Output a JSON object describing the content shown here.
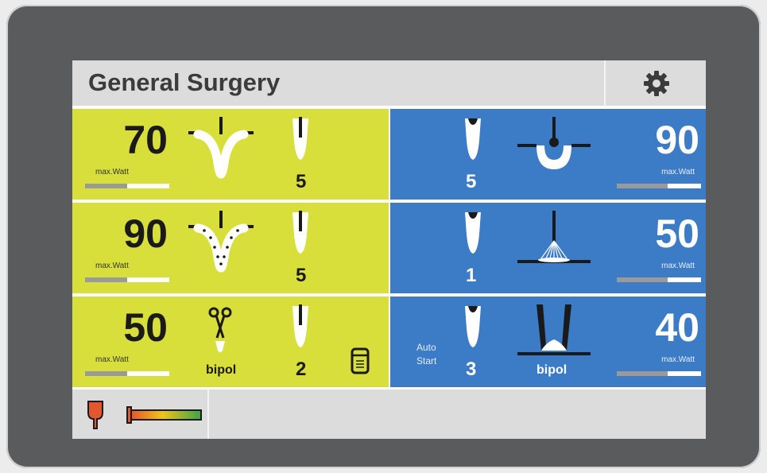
{
  "header": {
    "title": "General Surgery",
    "settings_icon": "gear-icon"
  },
  "unit_label": "max.Watt",
  "monopolar": [
    {
      "power": "70",
      "mode_icon": "cut-mode-icon",
      "electrode_icon": "electrode-tip-icon",
      "level": "5",
      "power_fraction": 0.5
    },
    {
      "power": "90",
      "mode_icon": "blend-cut-mode-icon",
      "electrode_icon": "electrode-tip-icon",
      "level": "5",
      "power_fraction": 0.5
    },
    {
      "power": "50",
      "mode_icon": "bipolar-scissors-icon",
      "mode_label": "bipol",
      "electrode_icon": "electrode-tip-icon",
      "level": "2",
      "extra_icon": "footswitch-icon",
      "power_fraction": 0.5
    }
  ],
  "coagulation": [
    {
      "power": "90",
      "mode_icon": "soft-coag-icon",
      "electrode_icon": "electrode-tip-icon",
      "level": "5",
      "power_fraction": 0.6
    },
    {
      "power": "50",
      "mode_icon": "spray-coag-icon",
      "electrode_icon": "electrode-tip-icon",
      "level": "1",
      "power_fraction": 0.6
    },
    {
      "power": "40",
      "mode_icon": "bipolar-coag-icon",
      "mode_label": "bipol",
      "electrode_icon": "electrode-tip-icon",
      "level": "3",
      "auto_start": [
        "Auto",
        "Start"
      ],
      "power_fraction": 0.6
    }
  ],
  "footer": {
    "neutral_electrode_icon": "neutral-electrode-icon",
    "contact_quality_icon": "contact-quality-gauge-icon"
  },
  "colors": {
    "cut": "#d9df3a",
    "coag": "#3c7bc6",
    "bezel": "#5a5b5d",
    "header": "#dcdcdc",
    "alert": "#e4572e"
  }
}
